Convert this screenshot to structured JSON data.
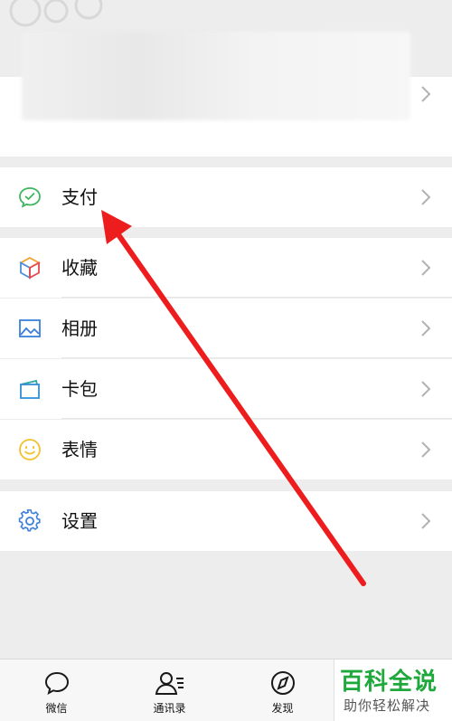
{
  "menu": {
    "pay": "支付",
    "favorites": "收藏",
    "album": "相册",
    "cards": "卡包",
    "stickers": "表情",
    "settings": "设置"
  },
  "nav": {
    "chats": "微信",
    "contacts": "通讯录",
    "discover": "发现"
  },
  "watermark": {
    "title": "百科全说",
    "subtitle": "助你轻松解决"
  },
  "colors": {
    "pay_green": "#3fb55f",
    "arrow_red": "#ee1d1d",
    "watermark_green": "#1fa83b"
  },
  "icons": [
    "pay-icon",
    "favorites-icon",
    "album-icon",
    "cards-icon",
    "stickers-icon",
    "settings-icon",
    "chevron-right-icon",
    "chats-icon",
    "contacts-icon",
    "discover-icon"
  ]
}
